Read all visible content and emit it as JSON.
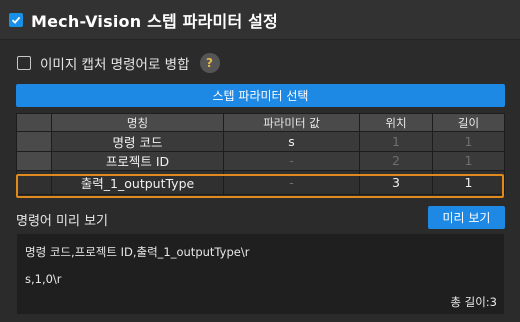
{
  "header": {
    "title": "Mech-Vision 스텝 파라미터 설정",
    "enabled": true
  },
  "merge": {
    "label": "이미지 캡처 명령어로 병합",
    "help": "?",
    "checked": false
  },
  "select_button": {
    "label": "스텝 파라미터 선택"
  },
  "table": {
    "columns": [
      "명칭",
      "파라미터 값",
      "위치",
      "길이"
    ],
    "rows": [
      {
        "name": "명령 코드",
        "value": "s",
        "position": "1",
        "length": "1"
      },
      {
        "name": "프로젝트 ID",
        "value": "-",
        "position": "2",
        "length": "1"
      },
      {
        "name": "출력_1_outputType",
        "value": "-",
        "position": "3",
        "length": "1"
      }
    ]
  },
  "preview": {
    "label": "명령어 미리 보기",
    "button": "미리 보기",
    "line1": "명령 코드,프로젝트 ID,출력_1_outputType\\r",
    "line2": "s,1,0\\r",
    "total_length": "총 길이:3"
  },
  "colors": {
    "accent": "#1e88e5",
    "selection": "#e08a1e",
    "help_icon": "#e6b84a"
  }
}
